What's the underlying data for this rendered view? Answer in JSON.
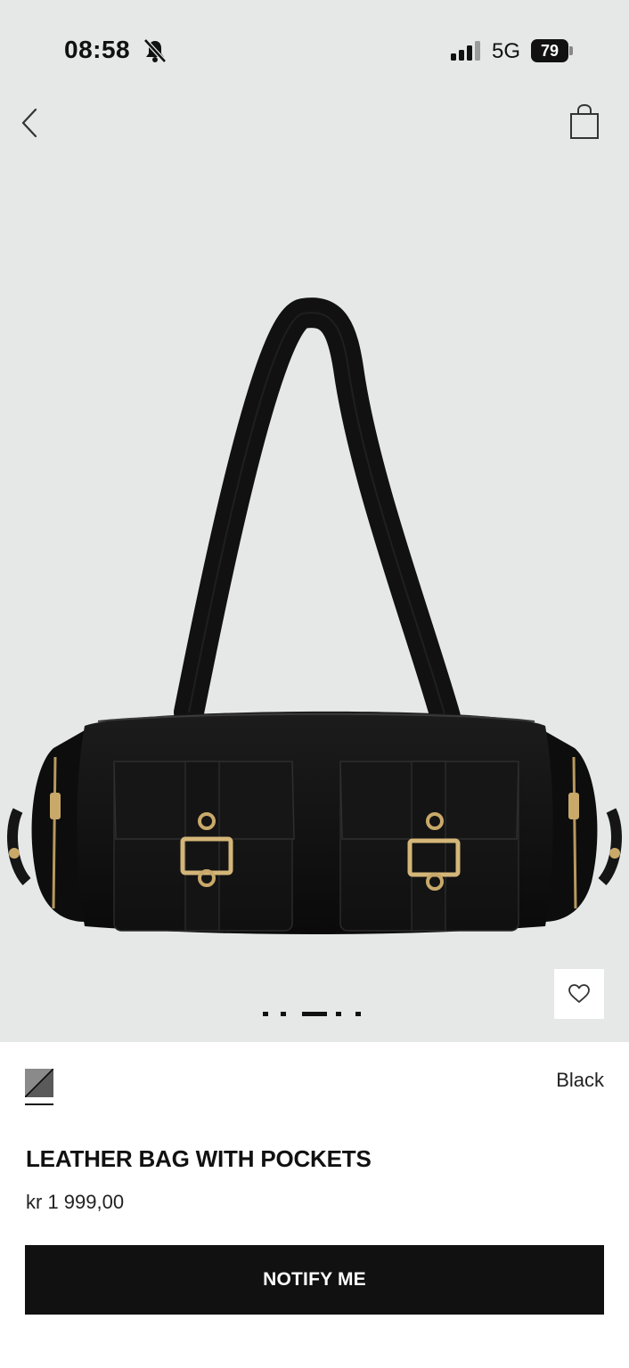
{
  "status_bar": {
    "time": "08:58",
    "network": "5G",
    "battery": "79",
    "icons": [
      "bell-slash-icon",
      "signal-icon",
      "battery-icon"
    ]
  },
  "nav": {
    "back_icon": "chevron-left-icon",
    "bag_icon": "shopping-bag-icon"
  },
  "gallery": {
    "image_subject": "black leather shoulder bag with two front buckle pockets",
    "wishlist_icon": "heart-icon",
    "page_count": 5,
    "active_page": 3
  },
  "product": {
    "color_name": "Black",
    "title": "LEATHER BAG WITH POCKETS",
    "price": "kr 1 999,00"
  },
  "actions": {
    "notify_label": "NOTIFY ME"
  },
  "colors": {
    "hero_background": "#e6e8e8",
    "button_background": "#111111",
    "button_text": "#ffffff"
  }
}
